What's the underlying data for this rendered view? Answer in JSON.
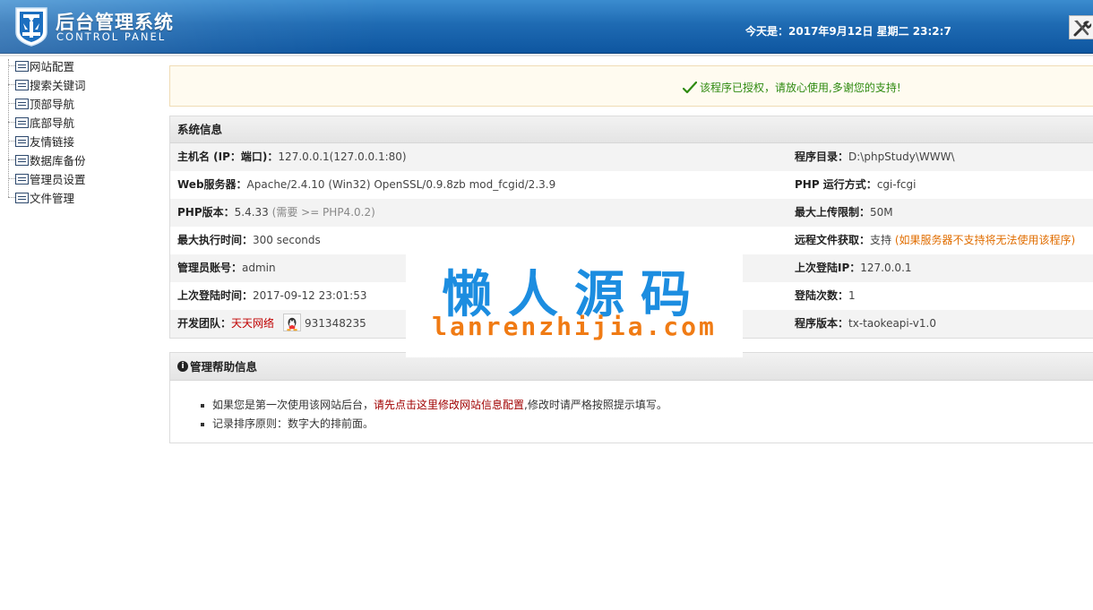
{
  "header": {
    "title": "后台管理系统",
    "subtitle": "CONTROL PANEL",
    "date_text": "今天是：2017年9月12日 星期二 23:2:7",
    "tool_icon": "tools-icon"
  },
  "sidebar": {
    "items": [
      {
        "label": "网站配置"
      },
      {
        "label": "搜索关键词"
      },
      {
        "label": "顶部导航"
      },
      {
        "label": "底部导航"
      },
      {
        "label": "友情链接"
      },
      {
        "label": "数据库备份"
      },
      {
        "label": "管理员设置"
      },
      {
        "label": "文件管理"
      }
    ]
  },
  "notice": {
    "text": "该程序已授权，请放心使用,多谢您的支持!",
    "color": "#2e8a10"
  },
  "system_info": {
    "title": "系统信息",
    "rows": [
      {
        "left_key": "主机名 (IP：端口)：",
        "left_value": "127.0.0.1(127.0.0.1:80)",
        "right_key": "程序目录：",
        "right_value": "D:\\phpStudy\\WWW\\"
      },
      {
        "left_key": "Web服务器：",
        "left_value": "Apache/2.4.10 (Win32) OpenSSL/0.9.8zb mod_fcgid/2.3.9",
        "right_key": "PHP 运行方式：",
        "right_value": "cgi-fcgi"
      },
      {
        "left_key": "PHP版本：",
        "left_value": "5.4.33",
        "left_note": "(需要 >= PHP4.0.2)",
        "right_key": "最大上传限制：",
        "right_value": "50M"
      },
      {
        "left_key": "最大执行时间：",
        "left_value": "300 seconds",
        "right_key": "远程文件获取：",
        "right_value": "支持",
        "right_note": "(如果服务器不支持将无法使用该程序)"
      },
      {
        "left_key": "管理员账号：",
        "left_value": "admin",
        "right_key": "上次登陆IP：",
        "right_value": "127.0.0.1"
      },
      {
        "left_key": "上次登陆时间：",
        "left_value": "2017-09-12 23:01:53",
        "right_key": "登陆次数：",
        "right_value": "1"
      },
      {
        "left_key": "开发团队：",
        "left_value": "天天网络",
        "left_qq": "931348235",
        "right_key": "程序版本：",
        "right_value": "tx-taokeapi-v1.0"
      }
    ]
  },
  "help": {
    "title": "管理帮助信息",
    "items": [
      {
        "prefix": "如果您是第一次使用该网站后台，",
        "link": "请先点击这里修改网站信息配置",
        "suffix": ",修改时请严格按照提示填写。"
      },
      {
        "prefix": "记录排序原则：数字大的排前面。",
        "link": "",
        "suffix": ""
      }
    ]
  },
  "watermark": {
    "cn": "懒人源码",
    "en": "lanrenzhijia.com",
    "color_cn": "#1c8de0",
    "color_en": "#f07b14"
  },
  "colors": {
    "header_blue": "#1f6bb3",
    "link_red": "#a00000",
    "note_orange": "#e06d00"
  }
}
